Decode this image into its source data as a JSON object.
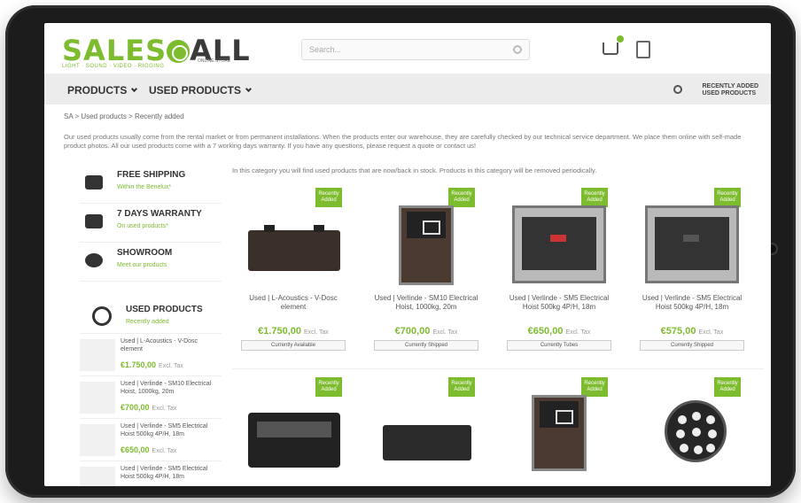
{
  "site": {
    "logo_left": "SALES",
    "logo_right": "ALL",
    "logo_tagline": "LIGHT · SOUND · VIDEO · RIGGING",
    "logo_sub": "ONLINE STORE",
    "search_placeholder": "Search..."
  },
  "nav": {
    "items": [
      "PRODUCTS",
      "USED PRODUCTS"
    ],
    "recently_added": "RECENTLY ADDED\nUSED PRODUCTS"
  },
  "breadcrumb": "SA  >  Used products  >  Recently added",
  "intro": "Our used products usually come from the rental market or from permanent installations. When the products enter our warehouse, they are carefully checked by our technical service department. We place them online with self-made product photos. All our used products come with a 7 working days warranty. If you have any questions, please request a quote or contact us!",
  "sidebar": {
    "features": [
      {
        "title": "FREE SHIPPING",
        "sub": "Within the Benelux*",
        "icon": "truck-icon"
      },
      {
        "title": "7 DAYS WARRANTY",
        "sub": "On used products*",
        "icon": "calendar-check-icon"
      },
      {
        "title": "SHOWROOM",
        "sub": "Meet our products",
        "icon": "eye-icon"
      }
    ],
    "used": {
      "title": "USED PRODUCTS",
      "sub": "Recently added",
      "items": [
        {
          "name": "Used | L-Acoustics - V-Dosc element",
          "price": "€1.750,00",
          "tax": "Excl. Tax"
        },
        {
          "name": "Used | Verlinde - SM10 Electrical Hoist, 1000kg, 20m",
          "price": "€700,00",
          "tax": "Excl. Tax"
        },
        {
          "name": "Used | Verlinde - SM5 Electrical Hoist 500kg 4P/H, 18m",
          "price": "€650,00",
          "tax": "Excl. Tax"
        },
        {
          "name": "Used | Verlinde - SM5 Electrical Hoist 500kg 4P/H, 18m",
          "price": "",
          "tax": ""
        }
      ]
    }
  },
  "lead": "In this category you will find used products that are now/back in stock. Products in this category will be removed periodically.",
  "products": [
    {
      "badge": "Recently Added",
      "name": "Used | L-Acoustics - V-Dosc element",
      "price": "€1.750,00",
      "tax": "Excl. Tax",
      "stock": "Currently Available",
      "img": "crate"
    },
    {
      "badge": "Recently Added",
      "name": "Used | Verlinde - SM10 Electrical Hoist, 1000kg, 20m",
      "price": "€700,00",
      "tax": "Excl. Tax",
      "stock": "Currently Shipped",
      "img": "case"
    },
    {
      "badge": "Recently Added",
      "name": "Used | Verlinde - SM5 Electrical Hoist 500kg 4P/H, 18m",
      "price": "€650,00",
      "tax": "Excl. Tax",
      "stock": "Currently Tubes",
      "img": "open"
    },
    {
      "badge": "Recently Added",
      "name": "Used | Verlinde - SM5 Electrical Hoist 500kg 4P/H, 18m",
      "price": "€575,00",
      "tax": "Excl. Tax",
      "stock": "Currently Shipped",
      "img": "open"
    },
    {
      "badge": "Recently Added",
      "name": "",
      "price": "",
      "tax": "",
      "stock": "",
      "img": "dev"
    },
    {
      "badge": "Recently Added",
      "name": "",
      "price": "",
      "tax": "",
      "stock": "",
      "img": "spk"
    },
    {
      "badge": "Recently Added",
      "name": "",
      "price": "",
      "tax": "",
      "stock": "",
      "img": "case"
    },
    {
      "badge": "Recently Added",
      "name": "",
      "price": "",
      "tax": "",
      "stock": "",
      "img": "par"
    }
  ],
  "colors": {
    "accent": "#7dbb2f",
    "text": "#333333",
    "bezel": "#1c1c1c"
  }
}
